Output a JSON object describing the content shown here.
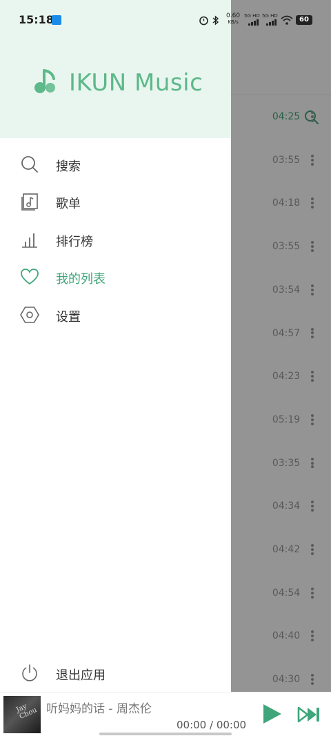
{
  "status_bar": {
    "time": "15:18",
    "net_speed_value": "0.60",
    "net_speed_unit": "KB/s",
    "sim1": "5G HD",
    "sim2": "5G HD",
    "battery": "60"
  },
  "drawer": {
    "app_name": "IKUN Music",
    "menu": [
      {
        "label": "搜索",
        "icon": "search-icon"
      },
      {
        "label": "歌单",
        "icon": "playlist-icon"
      },
      {
        "label": "排行榜",
        "icon": "chart-bars-icon"
      },
      {
        "label": "我的列表",
        "icon": "heart-icon",
        "active": true
      },
      {
        "label": "设置",
        "icon": "settings-hexagon-icon"
      }
    ],
    "exit_label": "退出应用"
  },
  "song_list": {
    "durations": [
      "04:25",
      "03:55",
      "04:18",
      "03:55",
      "03:54",
      "04:57",
      "04:23",
      "05:19",
      "03:35",
      "04:34",
      "04:42",
      "04:54",
      "04:40",
      "04:30"
    ]
  },
  "player": {
    "track": "听妈妈的话 - 周杰伦",
    "time": "00:00 / 00:00",
    "cover_text": "Jay Chou"
  },
  "colors": {
    "accent": "#3ea67a",
    "drawer_header_bg": "#e9f6ef",
    "scrim": "rgba(0,0,0,0.42)"
  }
}
